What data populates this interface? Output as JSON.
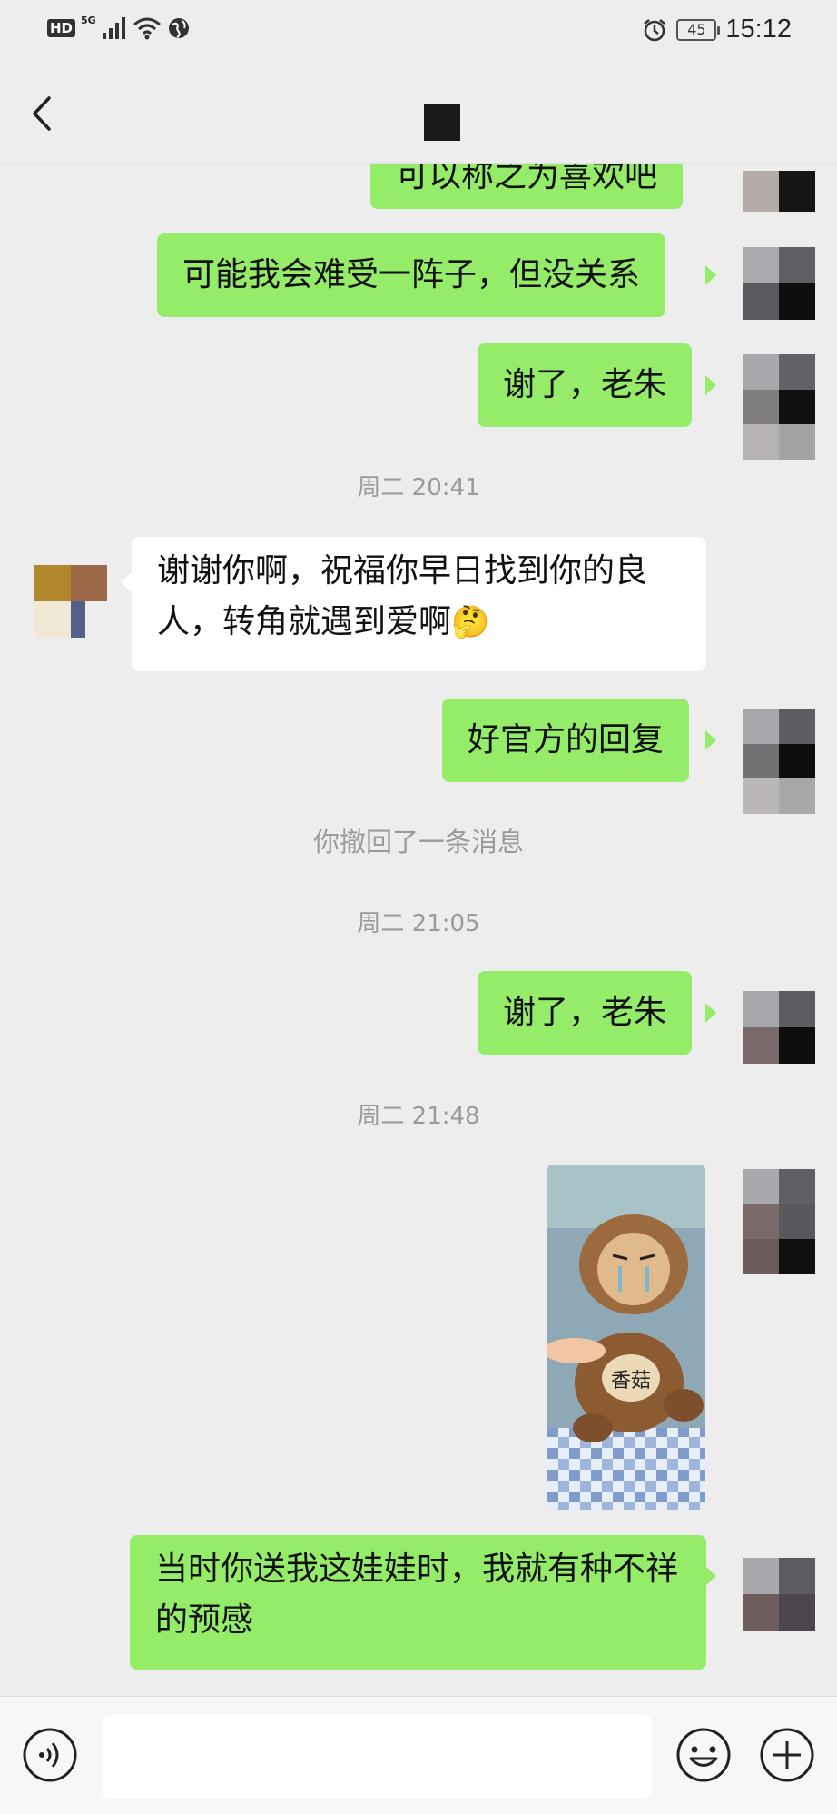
{
  "status_bar": {
    "hd": "HD",
    "network": "5G",
    "battery": "45",
    "time": "15:12"
  },
  "header": {
    "title_icon": "redacted-contact-name-block",
    "back_icon": "chevron-left-icon"
  },
  "messages": [
    {
      "side": "right",
      "text": "可以称之为喜欢吧"
    },
    {
      "side": "right",
      "text": "可能我会难受一阵子，但没关系"
    },
    {
      "side": "right",
      "text": "谢了，老朱"
    },
    {
      "type": "time",
      "text": "周二 20:41"
    },
    {
      "side": "left",
      "text": "谢谢你啊，祝福你早日找到你的良人，转角就遇到爱啊",
      "emoji": "🤔"
    },
    {
      "side": "right",
      "text": "好官方的回复"
    },
    {
      "type": "system",
      "text": "你撤回了一条消息"
    },
    {
      "type": "time",
      "text": "周二 21:05"
    },
    {
      "side": "right",
      "text": "谢了，老朱"
    },
    {
      "type": "time",
      "text": "周二 21:48"
    },
    {
      "side": "right",
      "type": "image",
      "caption_text": "香菇"
    },
    {
      "side": "right",
      "text": "当时你送我这娃娃时，我就有种不祥的预感"
    }
  ],
  "input_bar": {
    "voice_icon": "voice-input-icon",
    "emoji_icon": "emoji-icon",
    "plus_icon": "plus-icon"
  },
  "colors": {
    "bubble_self": "#95ec69",
    "bubble_other": "#ffffff",
    "background": "#ededed",
    "time_text": "#9a9a9a"
  }
}
